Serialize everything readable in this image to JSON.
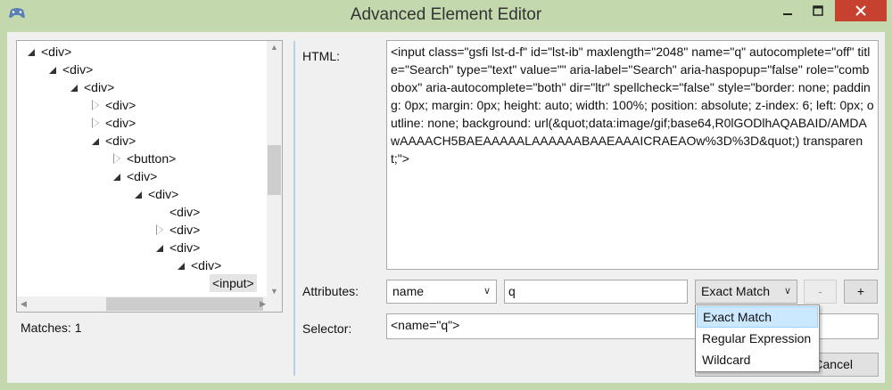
{
  "window": {
    "title": "Advanced Element Editor",
    "app_icon": "gamepad-icon"
  },
  "tree": {
    "nodes": [
      {
        "label": "<div>",
        "depth": 0,
        "expander": "open"
      },
      {
        "label": "<div>",
        "depth": 1,
        "expander": "open"
      },
      {
        "label": "<div>",
        "depth": 2,
        "expander": "open"
      },
      {
        "label": "<div>",
        "depth": 3,
        "expander": "closed"
      },
      {
        "label": "<div>",
        "depth": 3,
        "expander": "closed"
      },
      {
        "label": "<div>",
        "depth": 3,
        "expander": "open"
      },
      {
        "label": "<button>",
        "depth": 4,
        "expander": "closed"
      },
      {
        "label": "<div>",
        "depth": 4,
        "expander": "open"
      },
      {
        "label": "<div>",
        "depth": 5,
        "expander": "open"
      },
      {
        "label": "<div>",
        "depth": 6,
        "expander": "none"
      },
      {
        "label": "<div>",
        "depth": 6,
        "expander": "closed"
      },
      {
        "label": "<div>",
        "depth": 6,
        "expander": "open"
      },
      {
        "label": "<div>",
        "depth": 7,
        "expander": "open"
      },
      {
        "label": "<input>",
        "depth": 8,
        "expander": "none",
        "selected": true
      }
    ]
  },
  "matches_label": "Matches: 1",
  "editor": {
    "html_label": "HTML:",
    "html_value": "<input class=\"gsfi lst-d-f\" id=\"lst-ib\" maxlength=\"2048\" name=\"q\" autocomplete=\"off\" title=\"Search\" type=\"text\" value=\"\" aria-label=\"Search\" aria-haspopup=\"false\" role=\"combobox\" aria-autocomplete=\"both\" dir=\"ltr\" spellcheck=\"false\" style=\"border: none; padding: 0px; margin: 0px; height: auto; width: 100%; position: absolute; z-index: 6; left: 0px; outline: none; background: url(&quot;data:image/gif;base64,R0lGODlhAQABAID/AMDAwAAAACH5BAEAAAAALAAAAAABAAEAAAICRAEAOw%3D%3D&quot;) transparent;\">",
    "attributes_label": "Attributes:",
    "attribute_name": "name",
    "attribute_value": "q",
    "match_mode": "Exact Match",
    "remove_label": "-",
    "add_label": "+",
    "selector_label": "Selector:",
    "selector_value": "<name=\"q\">",
    "cancel_label": "Cancel",
    "match_options": [
      "Exact Match",
      "Regular Expression",
      "Wildcard"
    ]
  }
}
